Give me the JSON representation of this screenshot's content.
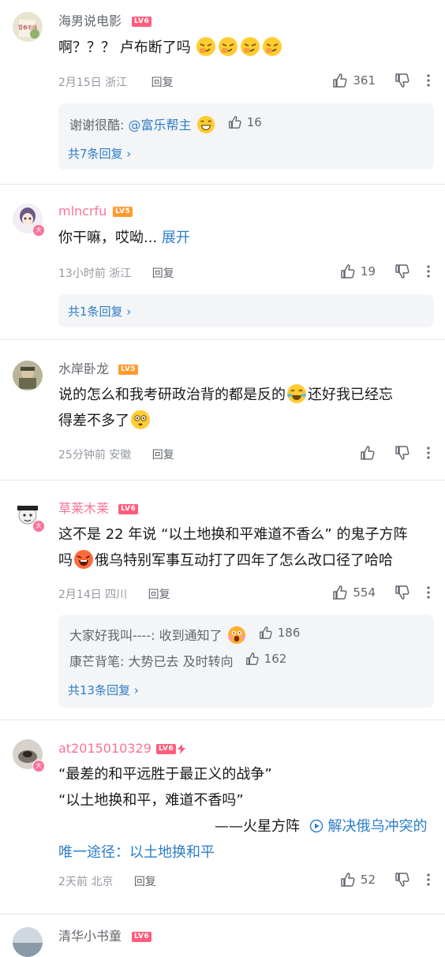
{
  "comments": [
    {
      "username": "海男说电影",
      "level": "LV6",
      "text": "啊？？？ 卢布断了吗",
      "time_location": "2月15日 浙江",
      "reply_label": "回复",
      "likes": "361",
      "sub_replies": [
        {
          "prefix": "谢谢很酷: ",
          "mention": "@富乐帮主",
          "likes": "16"
        }
      ],
      "more_link": "共7条回复 ›"
    },
    {
      "username": "mlncrfu",
      "level": "LV5",
      "text": "你干嘛，哎呦...",
      "expand": "展开",
      "time_location": "13小时前 浙江",
      "reply_label": "回复",
      "likes": "19",
      "more_link": "共1条回复 ›"
    },
    {
      "username": "水岸卧龙",
      "level": "LV5",
      "text_a": "说的怎么和我考研政治背的都是反的",
      "text_b": "还好我已经忘",
      "text_c": "得差不多了",
      "time_location": "25分钟前 安徽",
      "reply_label": "回复"
    },
    {
      "username": "草莱木莱",
      "level": "LV6",
      "text_a": "这不是 22 年说 “以土地换和平难道不香么” 的鬼子方阵",
      "text_b": "吗",
      "text_c": "俄乌特别军事互动打了四年了怎么改口径了哈哈",
      "time_location": "2月14日 四川",
      "reply_label": "回复",
      "likes": "554",
      "sub_replies": [
        {
          "prefix": "大家好我叫----: 收到通知了",
          "likes": "186"
        },
        {
          "prefix": "康芒背笔: 大势已去 及时转向",
          "likes": "162"
        }
      ],
      "more_link": "共13条回复 ›"
    },
    {
      "username": "at2015010329",
      "level": "LV6",
      "line1": "“最差的和平远胜于最正义的战争”",
      "line2": "“以土地换和平，难道不香吗”",
      "line3_prefix": "——火星方阵",
      "line3_link": "解决俄乌冲突的",
      "line4": "唯一途径：以土地换和平",
      "time_location": "2天前 北京",
      "reply_label": "回复",
      "likes": "52"
    },
    {
      "username": "清华小书童",
      "level": "LV6"
    }
  ]
}
